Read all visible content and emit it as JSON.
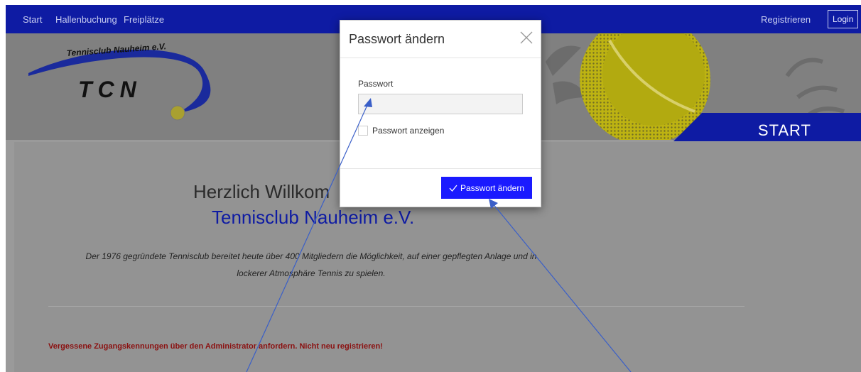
{
  "nav": {
    "links": [
      "Start",
      "Hallenbuchung",
      "Freiplätze"
    ],
    "register": "Registrieren",
    "login": "Login"
  },
  "logo": {
    "club_name": "Tennisclub Nauheim e.V.",
    "abbr": "TCN"
  },
  "banner": {
    "label": "START"
  },
  "main": {
    "welcome_line1": "Herzlich Willkom",
    "welcome_line2": "Tennisclub Nauheim e.V.",
    "intro_line1": "Der 1976 gegründete Tennisclub bereitet heute über 400 Mitgliedern die Möglichkeit, auf einer gepflegten Anlage und in",
    "intro_line2": "lockerer Atmosphäre Tennis zu spielen.",
    "warning": "Vergessene Zugangskennungen über den Administrator anfordern. Nicht neu registrieren!"
  },
  "modal": {
    "title": "Passwort ändern",
    "field_label": "Passwort",
    "password_value": "",
    "show_password_label": "Passwort anzeigen",
    "submit_label": "Passwort ändern"
  },
  "colors": {
    "brand_blue": "#0e1ba3",
    "button_blue": "#1a1aff",
    "warning_red": "#8b1010",
    "ball_yellow": "#f3ee1a"
  }
}
